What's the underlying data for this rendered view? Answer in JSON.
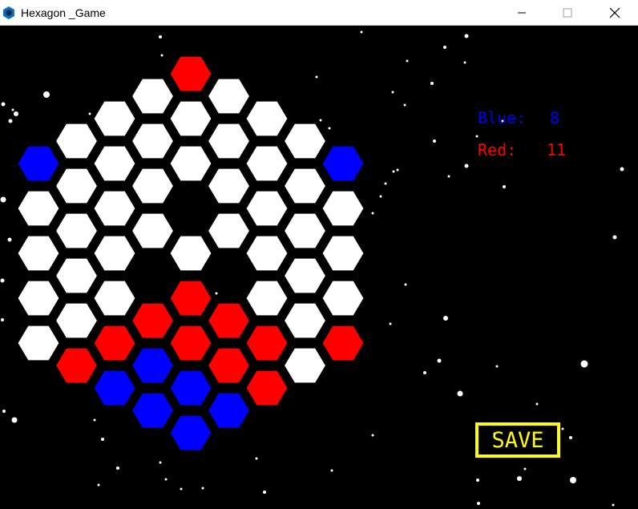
{
  "window": {
    "title": "Hexagon _Game",
    "app_icon": "hexagon-app-icon",
    "controls": [
      "minimize-icon",
      "maximize-icon",
      "close-icon"
    ]
  },
  "score": {
    "blue_label": "Blue:",
    "blue_value": "8",
    "red_label": "Red:",
    "red_value": "11"
  },
  "save": {
    "label": "SAVE"
  },
  "colors": {
    "blue": "#0000ff",
    "red": "#ff0000",
    "empty": "#ffffff",
    "background": "#000000",
    "accent": "#ffff00"
  },
  "board": {
    "radius": 4,
    "cells": [
      {
        "q": 0,
        "r": -4,
        "state": "red"
      },
      {
        "q": -1,
        "r": -3,
        "state": "empty"
      },
      {
        "q": 1,
        "r": -4,
        "state": "empty"
      },
      {
        "q": -2,
        "r": -2,
        "state": "empty"
      },
      {
        "q": 0,
        "r": -3,
        "state": "empty"
      },
      {
        "q": 2,
        "r": -4,
        "state": "empty"
      },
      {
        "q": -3,
        "r": -1,
        "state": "empty"
      },
      {
        "q": -1,
        "r": -2,
        "state": "empty"
      },
      {
        "q": 1,
        "r": -3,
        "state": "empty"
      },
      {
        "q": 3,
        "r": -4,
        "state": "empty"
      },
      {
        "q": -4,
        "r": 0,
        "state": "blue"
      },
      {
        "q": -2,
        "r": -1,
        "state": "empty"
      },
      {
        "q": 0,
        "r": -2,
        "state": "empty"
      },
      {
        "q": 2,
        "r": -3,
        "state": "empty"
      },
      {
        "q": 4,
        "r": -4,
        "state": "blue"
      },
      {
        "q": -3,
        "r": 0,
        "state": "empty"
      },
      {
        "q": -1,
        "r": -1,
        "state": "empty"
      },
      {
        "q": 1,
        "r": -2,
        "state": "empty"
      },
      {
        "q": 3,
        "r": -3,
        "state": "empty"
      },
      {
        "q": -4,
        "r": 1,
        "state": "empty"
      },
      {
        "q": -2,
        "r": 0,
        "state": "empty"
      },
      {
        "q": 0,
        "r": -1,
        "state": "hole"
      },
      {
        "q": 2,
        "r": -2,
        "state": "empty"
      },
      {
        "q": 4,
        "r": -3,
        "state": "empty"
      },
      {
        "q": -3,
        "r": 1,
        "state": "empty"
      },
      {
        "q": -1,
        "r": 0,
        "state": "empty"
      },
      {
        "q": 1,
        "r": -1,
        "state": "empty"
      },
      {
        "q": 3,
        "r": -2,
        "state": "empty"
      },
      {
        "q": -4,
        "r": 2,
        "state": "empty"
      },
      {
        "q": -2,
        "r": 1,
        "state": "empty"
      },
      {
        "q": 0,
        "r": 0,
        "state": "empty"
      },
      {
        "q": 2,
        "r": -1,
        "state": "empty"
      },
      {
        "q": 4,
        "r": -2,
        "state": "empty"
      },
      {
        "q": -3,
        "r": 2,
        "state": "empty"
      },
      {
        "q": -1,
        "r": 1,
        "state": "hole"
      },
      {
        "q": 1,
        "r": 0,
        "state": "hole"
      },
      {
        "q": 3,
        "r": -1,
        "state": "empty"
      },
      {
        "q": -4,
        "r": 3,
        "state": "empty"
      },
      {
        "q": -2,
        "r": 2,
        "state": "empty"
      },
      {
        "q": 0,
        "r": 1,
        "state": "red"
      },
      {
        "q": 2,
        "r": 0,
        "state": "empty"
      },
      {
        "q": 4,
        "r": -1,
        "state": "empty"
      },
      {
        "q": -3,
        "r": 3,
        "state": "empty"
      },
      {
        "q": -1,
        "r": 2,
        "state": "red"
      },
      {
        "q": 1,
        "r": 1,
        "state": "red"
      },
      {
        "q": 3,
        "r": 0,
        "state": "empty"
      },
      {
        "q": -4,
        "r": 4,
        "state": "empty"
      },
      {
        "q": -2,
        "r": 3,
        "state": "red"
      },
      {
        "q": 0,
        "r": 2,
        "state": "red"
      },
      {
        "q": 2,
        "r": 1,
        "state": "red"
      },
      {
        "q": 4,
        "r": 0,
        "state": "red"
      },
      {
        "q": -3,
        "r": 4,
        "state": "red"
      },
      {
        "q": -1,
        "r": 3,
        "state": "blue"
      },
      {
        "q": 1,
        "r": 2,
        "state": "red"
      },
      {
        "q": 3,
        "r": 1,
        "state": "empty"
      },
      {
        "q": -2,
        "r": 4,
        "state": "blue"
      },
      {
        "q": 0,
        "r": 3,
        "state": "blue"
      },
      {
        "q": 2,
        "r": 2,
        "state": "red"
      },
      {
        "q": -1,
        "r": 4,
        "state": "blue"
      },
      {
        "q": 1,
        "r": 3,
        "state": "blue"
      },
      {
        "q": 0,
        "r": 4,
        "state": "blue"
      }
    ]
  },
  "stars": [
    [
      200,
      46,
      3
    ],
    [
      202,
      69,
      2
    ],
    [
      58,
      118,
      7
    ],
    [
      4,
      130,
      4
    ],
    [
      16,
      137,
      2
    ],
    [
      20,
      142,
      5
    ],
    [
      13,
      151,
      4
    ],
    [
      112,
      142,
      2
    ],
    [
      4,
      249,
      6
    ],
    [
      12,
      299,
      4
    ],
    [
      3,
      350,
      4
    ],
    [
      3,
      399,
      3
    ],
    [
      18,
      524,
      6
    ],
    [
      5,
      513,
      3
    ],
    [
      128,
      548,
      3
    ],
    [
      118,
      524,
      2
    ],
    [
      147,
      584,
      3
    ],
    [
      123,
      605,
      2
    ],
    [
      200,
      577,
      2
    ],
    [
      207,
      598,
      2
    ],
    [
      226,
      610,
      2
    ],
    [
      253,
      609,
      2
    ],
    [
      330,
      614,
      3
    ],
    [
      320,
      572,
      2
    ],
    [
      414,
      587,
      2
    ],
    [
      465,
      543,
      2
    ],
    [
      451,
      40,
      2
    ],
    [
      555,
      59,
      3
    ],
    [
      582,
      45,
      4
    ],
    [
      539,
      104,
      3
    ],
    [
      508,
      76,
      2
    ],
    [
      490,
      115,
      2
    ],
    [
      505,
      131,
      2
    ],
    [
      542,
      176,
      3
    ],
    [
      560,
      220,
      2
    ],
    [
      582,
      207,
      4
    ],
    [
      595,
      170,
      2
    ],
    [
      627,
      151,
      2
    ],
    [
      629,
      233,
      3
    ],
    [
      776,
      211,
      4
    ],
    [
      767,
      296,
      4
    ],
    [
      491,
      214,
      2
    ],
    [
      496,
      212,
      2
    ],
    [
      481,
      229,
      2
    ],
    [
      475,
      245,
      2
    ],
    [
      465,
      266,
      2
    ],
    [
      506,
      355,
      2
    ],
    [
      487,
      404,
      2
    ],
    [
      556,
      397,
      5
    ],
    [
      548,
      450,
      4
    ],
    [
      530,
      465,
      3
    ],
    [
      620,
      457,
      2
    ],
    [
      574,
      491,
      6
    ],
    [
      729,
      454,
      8
    ],
    [
      670,
      504,
      2
    ],
    [
      712,
      546,
      3
    ],
    [
      715,
      599,
      7
    ],
    [
      648,
      597,
      5
    ],
    [
      596,
      599,
      3
    ],
    [
      655,
      585,
      2
    ],
    [
      597,
      628,
      3
    ],
    [
      765,
      630,
      2
    ],
    [
      617,
      541,
      2
    ],
    [
      702,
      535,
      2
    ],
    [
      270,
      366,
      2
    ],
    [
      300,
      444,
      2
    ],
    [
      395,
      96,
      2
    ],
    [
      411,
      160,
      2
    ],
    [
      400,
      150,
      2
    ],
    [
      580,
      78,
      2
    ]
  ]
}
